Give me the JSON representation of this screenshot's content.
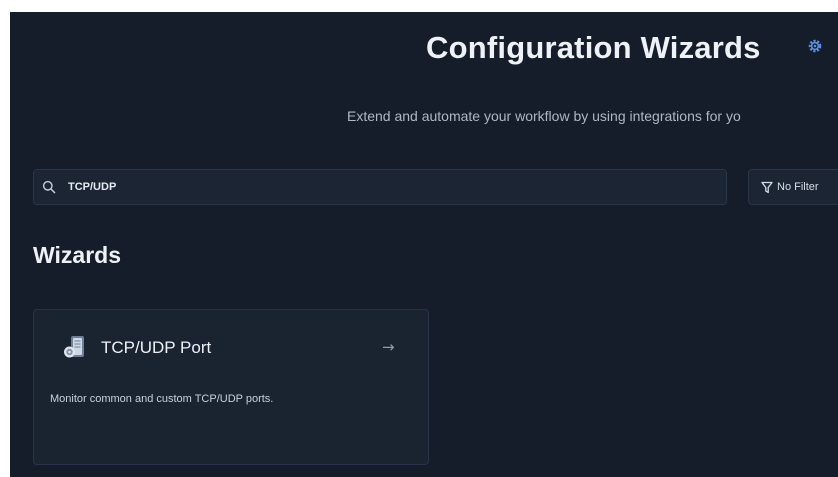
{
  "header": {
    "title": "Configuration Wizards",
    "title_icon": "gear-icon",
    "subtitle": "Extend and automate your workflow by using integrations for yo"
  },
  "search": {
    "value": "TCP/UDP",
    "icon": "search-icon"
  },
  "filter": {
    "label": "No Filter",
    "icon": "filter-icon"
  },
  "section": {
    "heading": "Wizards"
  },
  "wizards": [
    {
      "title": "TCP/UDP Port",
      "description": "Monitor common and custom TCP/UDP ports.",
      "icon": "server-port-icon",
      "arrow": "→"
    }
  ],
  "colors": {
    "background": "#141d29",
    "card": "#1a2431",
    "accent": "#4f7fd6"
  }
}
